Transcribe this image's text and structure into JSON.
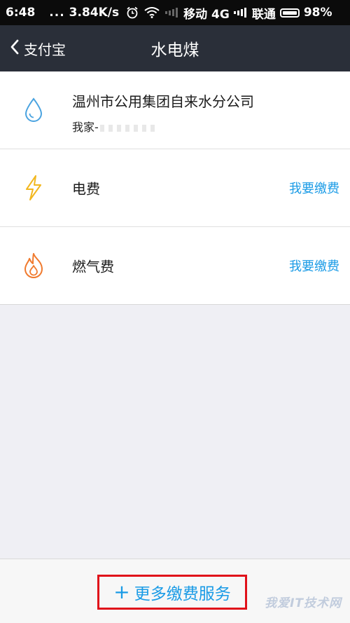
{
  "status_bar": {
    "time": "6:48",
    "dots": "...",
    "speed": "3.84K/s",
    "carrier1": "移动 4G",
    "carrier2": "联通",
    "battery": "98%"
  },
  "nav": {
    "back_label": "支付宝",
    "title": "水电煤"
  },
  "items": [
    {
      "name": "温州市公用集团自来水分公司",
      "subtitle": "我家-",
      "icon": "water-drop-icon",
      "color": "#4aa3e0"
    },
    {
      "name": "电费",
      "action": "我要缴费",
      "icon": "lightning-icon",
      "color": "#f2b71e"
    },
    {
      "name": "燃气费",
      "action": "我要缴费",
      "icon": "flame-icon",
      "color": "#f07a2e"
    }
  ],
  "bottom": {
    "plus": "+",
    "more_label": "更多缴费服务"
  },
  "watermark": "我爱IT技术网",
  "colors": {
    "accent": "#1a9be6",
    "nav_bg": "#2a2f39",
    "highlight_box": "#e0111a"
  }
}
